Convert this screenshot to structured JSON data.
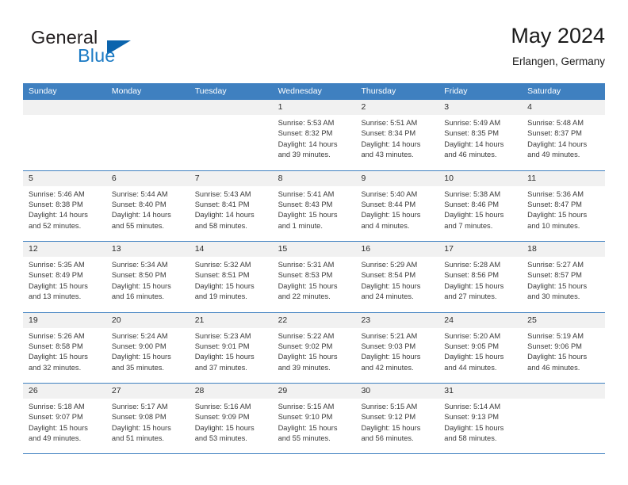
{
  "brand": {
    "name_part1": "General",
    "name_part2": "Blue",
    "triangle_color": "#0b64ad",
    "blue_color": "#1b7ac4"
  },
  "header": {
    "title": "May 2024",
    "subtitle": "Erlangen, Germany"
  },
  "theme": {
    "header_band": "#3f80c0",
    "daynum_band": "#f1f1f1",
    "row_divider": "#3f80c0"
  },
  "weekdays": [
    "Sunday",
    "Monday",
    "Tuesday",
    "Wednesday",
    "Thursday",
    "Friday",
    "Saturday"
  ],
  "weeks": [
    [
      {
        "day": "",
        "sunrise": "",
        "sunset": "",
        "daylight_a": "",
        "daylight_b": ""
      },
      {
        "day": "",
        "sunrise": "",
        "sunset": "",
        "daylight_a": "",
        "daylight_b": ""
      },
      {
        "day": "",
        "sunrise": "",
        "sunset": "",
        "daylight_a": "",
        "daylight_b": ""
      },
      {
        "day": "1",
        "sunrise": "Sunrise: 5:53 AM",
        "sunset": "Sunset: 8:32 PM",
        "daylight_a": "Daylight: 14 hours",
        "daylight_b": "and 39 minutes."
      },
      {
        "day": "2",
        "sunrise": "Sunrise: 5:51 AM",
        "sunset": "Sunset: 8:34 PM",
        "daylight_a": "Daylight: 14 hours",
        "daylight_b": "and 43 minutes."
      },
      {
        "day": "3",
        "sunrise": "Sunrise: 5:49 AM",
        "sunset": "Sunset: 8:35 PM",
        "daylight_a": "Daylight: 14 hours",
        "daylight_b": "and 46 minutes."
      },
      {
        "day": "4",
        "sunrise": "Sunrise: 5:48 AM",
        "sunset": "Sunset: 8:37 PM",
        "daylight_a": "Daylight: 14 hours",
        "daylight_b": "and 49 minutes."
      }
    ],
    [
      {
        "day": "5",
        "sunrise": "Sunrise: 5:46 AM",
        "sunset": "Sunset: 8:38 PM",
        "daylight_a": "Daylight: 14 hours",
        "daylight_b": "and 52 minutes."
      },
      {
        "day": "6",
        "sunrise": "Sunrise: 5:44 AM",
        "sunset": "Sunset: 8:40 PM",
        "daylight_a": "Daylight: 14 hours",
        "daylight_b": "and 55 minutes."
      },
      {
        "day": "7",
        "sunrise": "Sunrise: 5:43 AM",
        "sunset": "Sunset: 8:41 PM",
        "daylight_a": "Daylight: 14 hours",
        "daylight_b": "and 58 minutes."
      },
      {
        "day": "8",
        "sunrise": "Sunrise: 5:41 AM",
        "sunset": "Sunset: 8:43 PM",
        "daylight_a": "Daylight: 15 hours",
        "daylight_b": "and 1 minute."
      },
      {
        "day": "9",
        "sunrise": "Sunrise: 5:40 AM",
        "sunset": "Sunset: 8:44 PM",
        "daylight_a": "Daylight: 15 hours",
        "daylight_b": "and 4 minutes."
      },
      {
        "day": "10",
        "sunrise": "Sunrise: 5:38 AM",
        "sunset": "Sunset: 8:46 PM",
        "daylight_a": "Daylight: 15 hours",
        "daylight_b": "and 7 minutes."
      },
      {
        "day": "11",
        "sunrise": "Sunrise: 5:36 AM",
        "sunset": "Sunset: 8:47 PM",
        "daylight_a": "Daylight: 15 hours",
        "daylight_b": "and 10 minutes."
      }
    ],
    [
      {
        "day": "12",
        "sunrise": "Sunrise: 5:35 AM",
        "sunset": "Sunset: 8:49 PM",
        "daylight_a": "Daylight: 15 hours",
        "daylight_b": "and 13 minutes."
      },
      {
        "day": "13",
        "sunrise": "Sunrise: 5:34 AM",
        "sunset": "Sunset: 8:50 PM",
        "daylight_a": "Daylight: 15 hours",
        "daylight_b": "and 16 minutes."
      },
      {
        "day": "14",
        "sunrise": "Sunrise: 5:32 AM",
        "sunset": "Sunset: 8:51 PM",
        "daylight_a": "Daylight: 15 hours",
        "daylight_b": "and 19 minutes."
      },
      {
        "day": "15",
        "sunrise": "Sunrise: 5:31 AM",
        "sunset": "Sunset: 8:53 PM",
        "daylight_a": "Daylight: 15 hours",
        "daylight_b": "and 22 minutes."
      },
      {
        "day": "16",
        "sunrise": "Sunrise: 5:29 AM",
        "sunset": "Sunset: 8:54 PM",
        "daylight_a": "Daylight: 15 hours",
        "daylight_b": "and 24 minutes."
      },
      {
        "day": "17",
        "sunrise": "Sunrise: 5:28 AM",
        "sunset": "Sunset: 8:56 PM",
        "daylight_a": "Daylight: 15 hours",
        "daylight_b": "and 27 minutes."
      },
      {
        "day": "18",
        "sunrise": "Sunrise: 5:27 AM",
        "sunset": "Sunset: 8:57 PM",
        "daylight_a": "Daylight: 15 hours",
        "daylight_b": "and 30 minutes."
      }
    ],
    [
      {
        "day": "19",
        "sunrise": "Sunrise: 5:26 AM",
        "sunset": "Sunset: 8:58 PM",
        "daylight_a": "Daylight: 15 hours",
        "daylight_b": "and 32 minutes."
      },
      {
        "day": "20",
        "sunrise": "Sunrise: 5:24 AM",
        "sunset": "Sunset: 9:00 PM",
        "daylight_a": "Daylight: 15 hours",
        "daylight_b": "and 35 minutes."
      },
      {
        "day": "21",
        "sunrise": "Sunrise: 5:23 AM",
        "sunset": "Sunset: 9:01 PM",
        "daylight_a": "Daylight: 15 hours",
        "daylight_b": "and 37 minutes."
      },
      {
        "day": "22",
        "sunrise": "Sunrise: 5:22 AM",
        "sunset": "Sunset: 9:02 PM",
        "daylight_a": "Daylight: 15 hours",
        "daylight_b": "and 39 minutes."
      },
      {
        "day": "23",
        "sunrise": "Sunrise: 5:21 AM",
        "sunset": "Sunset: 9:03 PM",
        "daylight_a": "Daylight: 15 hours",
        "daylight_b": "and 42 minutes."
      },
      {
        "day": "24",
        "sunrise": "Sunrise: 5:20 AM",
        "sunset": "Sunset: 9:05 PM",
        "daylight_a": "Daylight: 15 hours",
        "daylight_b": "and 44 minutes."
      },
      {
        "day": "25",
        "sunrise": "Sunrise: 5:19 AM",
        "sunset": "Sunset: 9:06 PM",
        "daylight_a": "Daylight: 15 hours",
        "daylight_b": "and 46 minutes."
      }
    ],
    [
      {
        "day": "26",
        "sunrise": "Sunrise: 5:18 AM",
        "sunset": "Sunset: 9:07 PM",
        "daylight_a": "Daylight: 15 hours",
        "daylight_b": "and 49 minutes."
      },
      {
        "day": "27",
        "sunrise": "Sunrise: 5:17 AM",
        "sunset": "Sunset: 9:08 PM",
        "daylight_a": "Daylight: 15 hours",
        "daylight_b": "and 51 minutes."
      },
      {
        "day": "28",
        "sunrise": "Sunrise: 5:16 AM",
        "sunset": "Sunset: 9:09 PM",
        "daylight_a": "Daylight: 15 hours",
        "daylight_b": "and 53 minutes."
      },
      {
        "day": "29",
        "sunrise": "Sunrise: 5:15 AM",
        "sunset": "Sunset: 9:10 PM",
        "daylight_a": "Daylight: 15 hours",
        "daylight_b": "and 55 minutes."
      },
      {
        "day": "30",
        "sunrise": "Sunrise: 5:15 AM",
        "sunset": "Sunset: 9:12 PM",
        "daylight_a": "Daylight: 15 hours",
        "daylight_b": "and 56 minutes."
      },
      {
        "day": "31",
        "sunrise": "Sunrise: 5:14 AM",
        "sunset": "Sunset: 9:13 PM",
        "daylight_a": "Daylight: 15 hours",
        "daylight_b": "and 58 minutes."
      },
      {
        "day": "",
        "sunrise": "",
        "sunset": "",
        "daylight_a": "",
        "daylight_b": ""
      }
    ]
  ]
}
